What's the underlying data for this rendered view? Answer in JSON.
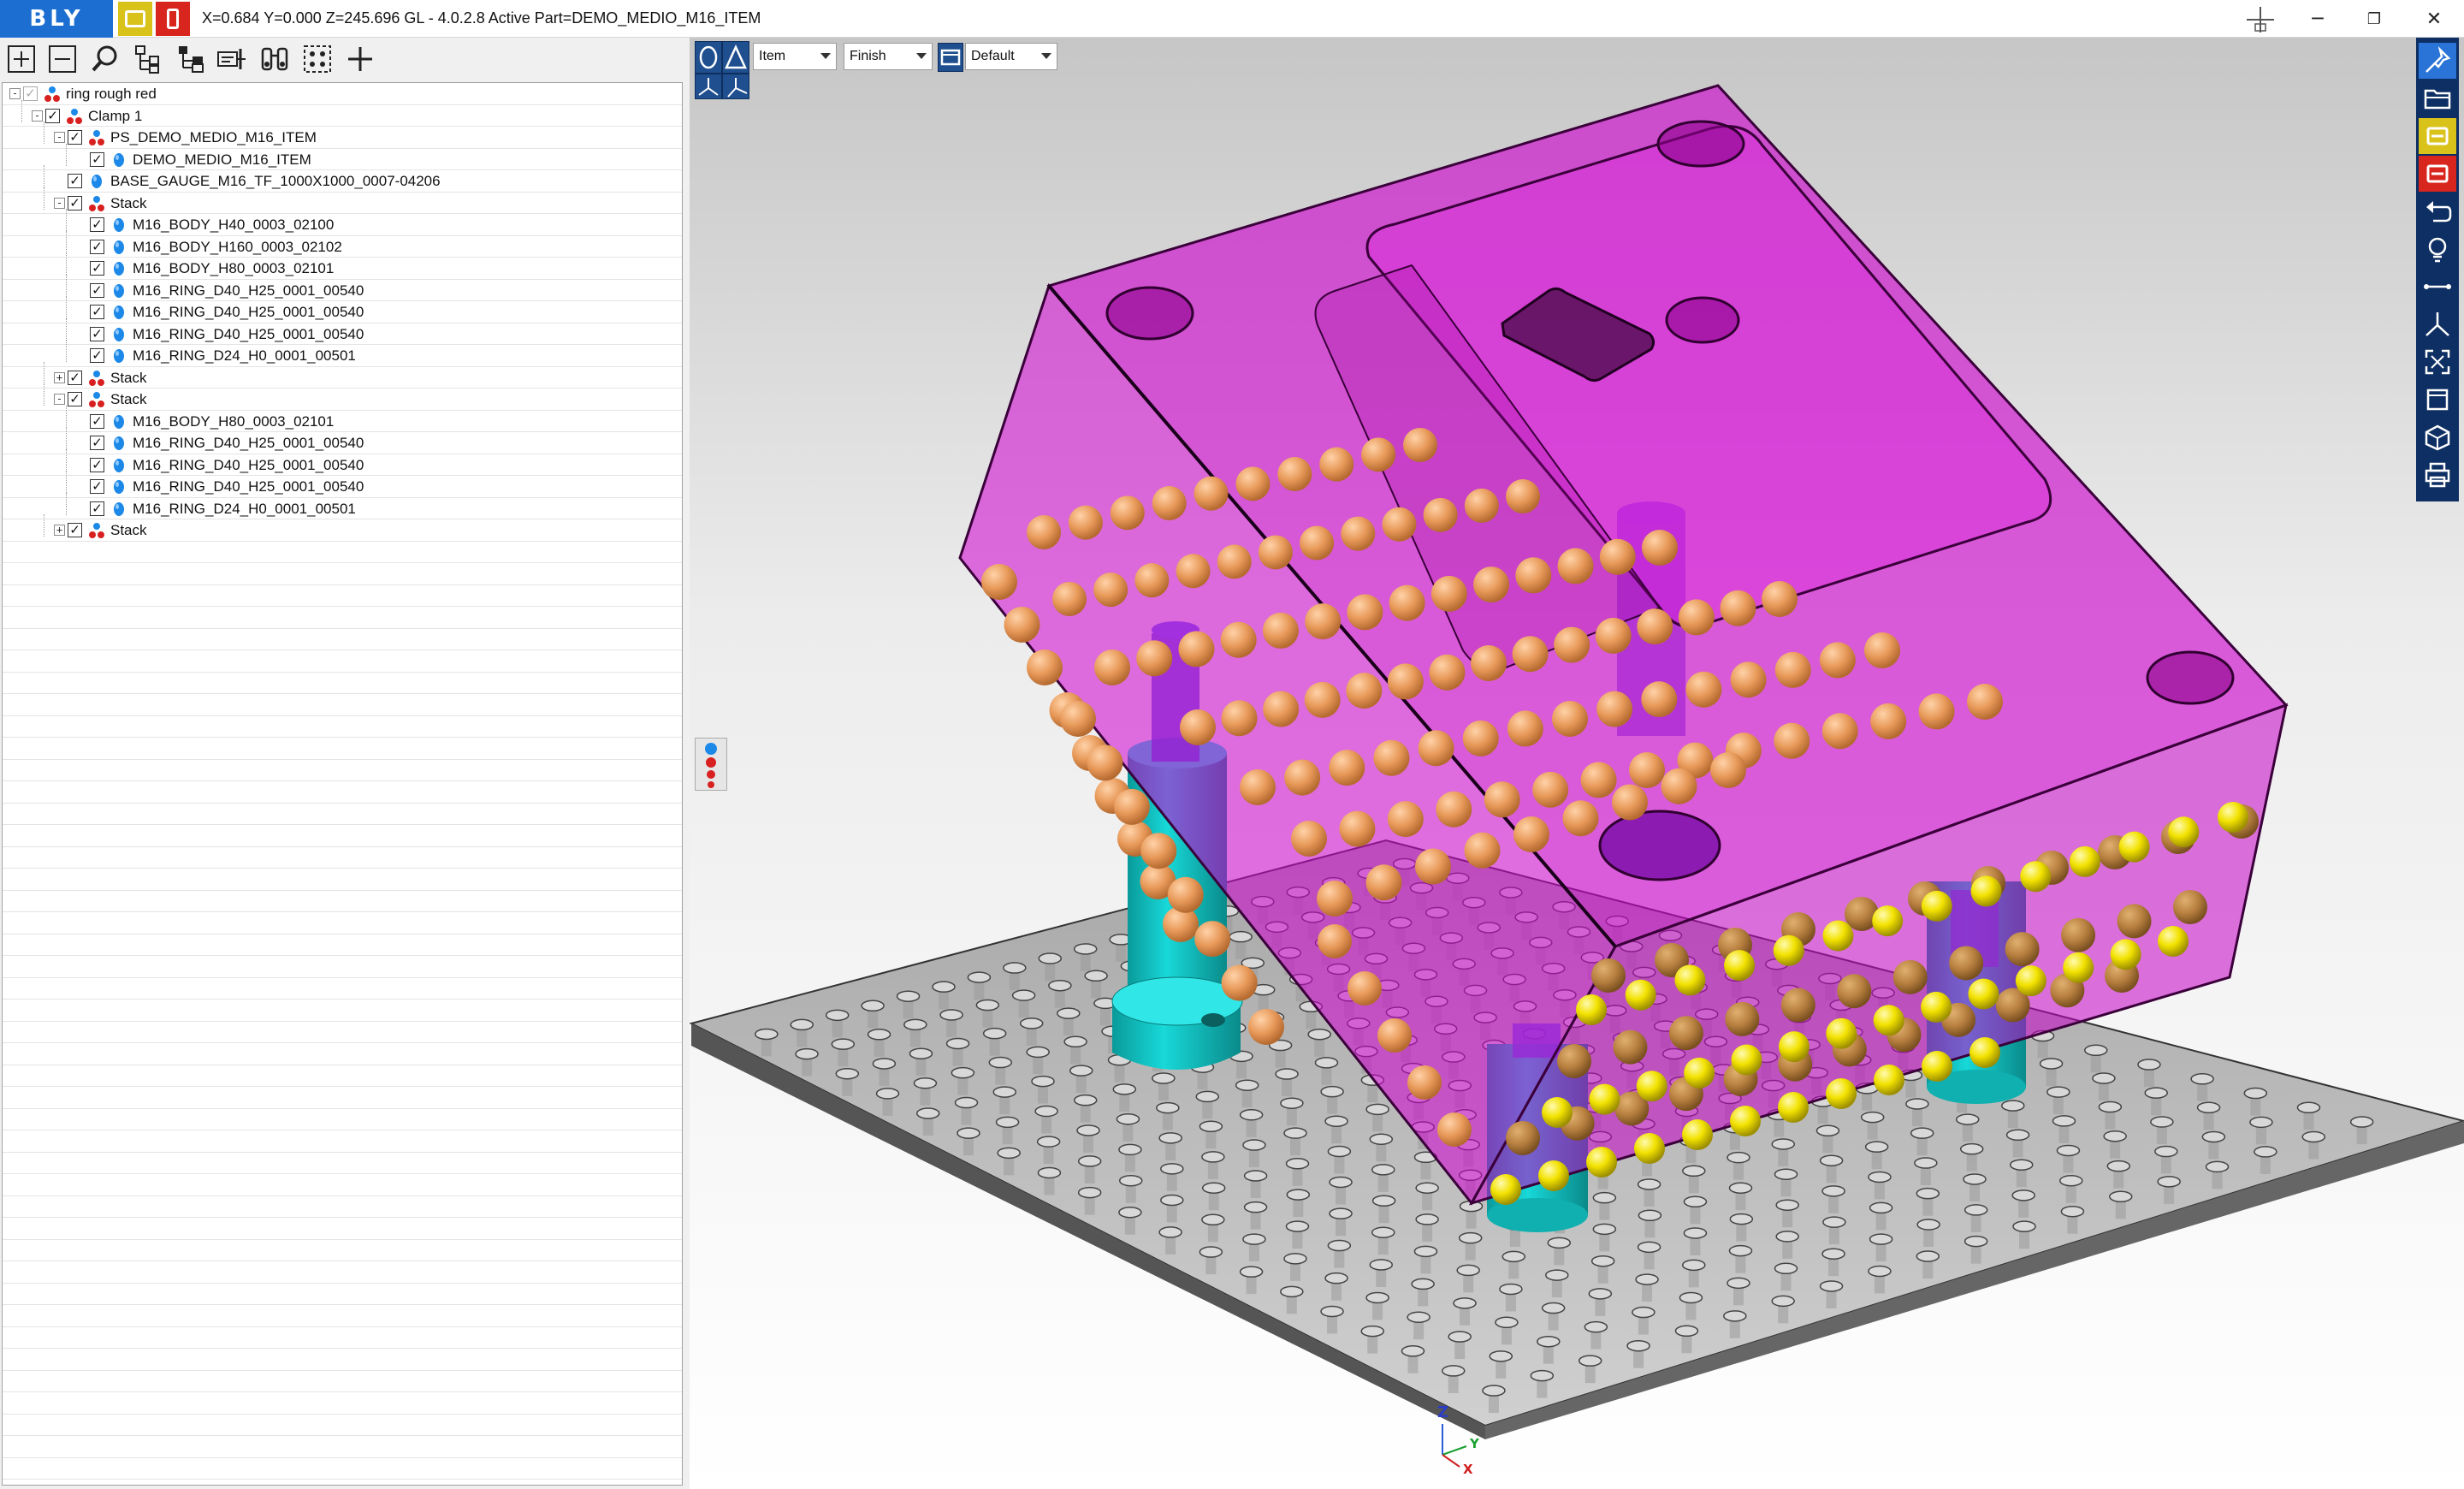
{
  "app": {
    "logo_text": "BLY",
    "status_text": "X=0.684 Y=0.000 Z=245.696   GL - 4.0.2.8 Active Part=DEMO_MEDIO_M16_ITEM",
    "window_controls": [
      "minimize-icon",
      "maximize-icon",
      "close-icon"
    ],
    "colors": {
      "brand_blue": "#1c6fd1",
      "yellow_badge": "#d9c21a",
      "red_badge": "#d8261f",
      "toolbar_navy": "#0d2f63",
      "part_magenta": "#c800c8",
      "pin_cyan": "#10c4c4",
      "sphere_orange": "#e8a060",
      "sphere_yellow": "#f0e000"
    }
  },
  "tree_toolbar": {
    "buttons": [
      "expand-all-icon",
      "collapse-all-icon",
      "search-icon",
      "tree-structure-icon",
      "tree-add-icon",
      "tree-move-icon",
      "binoculars-icon",
      "select-points-icon",
      "add-icon"
    ]
  },
  "tree": {
    "rows": [
      {
        "label": "ring rough red",
        "level": 0,
        "expander": "-",
        "checked": true,
        "dim": true,
        "icon": "assembly-icon"
      },
      {
        "label": "Clamp 1",
        "level": 1,
        "expander": "-",
        "checked": true,
        "dim": false,
        "icon": "assembly-icon"
      },
      {
        "label": "PS_DEMO_MEDIO_M16_ITEM",
        "level": 2,
        "expander": "-",
        "checked": true,
        "dim": false,
        "icon": "assembly-icon"
      },
      {
        "label": "DEMO_MEDIO_M16_ITEM",
        "level": 3,
        "expander": "",
        "checked": true,
        "dim": false,
        "icon": "part-icon"
      },
      {
        "label": "BASE_GAUGE_M16_TF_1000X1000_0007-04206",
        "level": 2,
        "expander": "",
        "checked": true,
        "dim": false,
        "icon": "part-icon"
      },
      {
        "label": "Stack",
        "level": 2,
        "expander": "-",
        "checked": true,
        "dim": false,
        "icon": "assembly-icon"
      },
      {
        "label": "M16_BODY_H40_0003_02100",
        "level": 3,
        "expander": "",
        "checked": true,
        "dim": false,
        "icon": "part-icon"
      },
      {
        "label": "M16_BODY_H160_0003_02102",
        "level": 3,
        "expander": "",
        "checked": true,
        "dim": false,
        "icon": "part-icon"
      },
      {
        "label": "M16_BODY_H80_0003_02101",
        "level": 3,
        "expander": "",
        "checked": true,
        "dim": false,
        "icon": "part-icon"
      },
      {
        "label": "M16_RING_D40_H25_0001_00540",
        "level": 3,
        "expander": "",
        "checked": true,
        "dim": false,
        "icon": "part-icon"
      },
      {
        "label": "M16_RING_D40_H25_0001_00540",
        "level": 3,
        "expander": "",
        "checked": true,
        "dim": false,
        "icon": "part-icon"
      },
      {
        "label": "M16_RING_D40_H25_0001_00540",
        "level": 3,
        "expander": "",
        "checked": true,
        "dim": false,
        "icon": "part-icon"
      },
      {
        "label": "M16_RING_D24_H0_0001_00501",
        "level": 3,
        "expander": "",
        "checked": true,
        "dim": false,
        "icon": "part-icon"
      },
      {
        "label": "Stack",
        "level": 2,
        "expander": "+",
        "checked": true,
        "dim": false,
        "icon": "assembly-icon"
      },
      {
        "label": "Stack",
        "level": 2,
        "expander": "-",
        "checked": true,
        "dim": false,
        "icon": "assembly-icon"
      },
      {
        "label": "M16_BODY_H80_0003_02101",
        "level": 3,
        "expander": "",
        "checked": true,
        "dim": false,
        "icon": "part-icon"
      },
      {
        "label": "M16_RING_D40_H25_0001_00540",
        "level": 3,
        "expander": "",
        "checked": true,
        "dim": false,
        "icon": "part-icon"
      },
      {
        "label": "M16_RING_D40_H25_0001_00540",
        "level": 3,
        "expander": "",
        "checked": true,
        "dim": false,
        "icon": "part-icon"
      },
      {
        "label": "M16_RING_D40_H25_0001_00540",
        "level": 3,
        "expander": "",
        "checked": true,
        "dim": false,
        "icon": "part-icon"
      },
      {
        "label": "M16_RING_D24_H0_0001_00501",
        "level": 3,
        "expander": "",
        "checked": true,
        "dim": false,
        "icon": "part-icon"
      },
      {
        "label": "Stack",
        "level": 2,
        "expander": "+",
        "checked": true,
        "dim": false,
        "icon": "assembly-icon"
      }
    ]
  },
  "viewport_toolbar": {
    "select_mode": "Item",
    "finish_mode": "Finish",
    "view_style": "Default",
    "icons": [
      "shading-icon",
      "triangle-icon",
      "display-icon",
      "view-front-icon",
      "view-side-icon"
    ]
  },
  "right_toolbar": {
    "buttons": [
      "pin-icon",
      "open-folder-icon",
      "yellow-badge-icon",
      "red-badge-icon",
      "undo-icon",
      "lightbulb-icon",
      "measure-line-icon",
      "axes-icon",
      "fit-view-icon",
      "window-icon",
      "cube-view-icon",
      "print-icon"
    ]
  },
  "axis_triad": {
    "z": "Z",
    "y": "Y",
    "x": "X"
  }
}
